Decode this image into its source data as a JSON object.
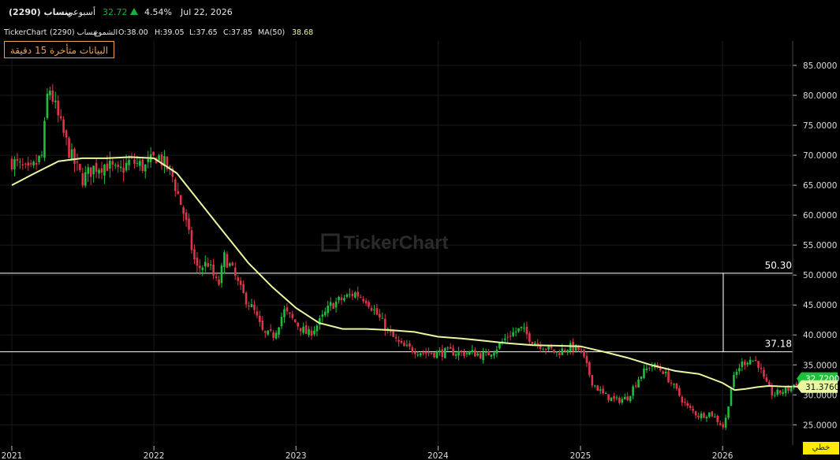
{
  "header": {
    "symbol": "ينساب (2290)",
    "timeframe": "أسبوعي",
    "last_price": "32.72",
    "change_percent": "4.54%",
    "date": "Jul 22, 2026",
    "up_color": "#18b13c",
    "arrow_icon": "triangle-up-icon"
  },
  "infobar": {
    "brand": "TickerChart",
    "symbol": "ينساب (2290)",
    "chart_kind": "الشموع",
    "open": "O:38.00",
    "high": "H:39.05",
    "low": "L:37.65",
    "close": "C:37.85",
    "ma_label": "MA(50)",
    "ma_value": "38.68"
  },
  "delay_notice": "البيانات متأخرة 15 دقيقة",
  "watermark": "TickerChart",
  "mode_badge": "خطي",
  "colors": {
    "up": "#1fbf3b",
    "down": "#e0344a",
    "ma": "#eaf7a1",
    "grid": "#1a1a1a",
    "hline": "#ffffff",
    "badge": "#f0a04b"
  },
  "chart_data": {
    "type": "candlestick",
    "title": "",
    "xlabel": "",
    "ylabel": "",
    "x_ticks": [
      "2021",
      "2022",
      "2023",
      "2024",
      "2025",
      "2026"
    ],
    "y_ticks": [
      "85.0000",
      "80.0000",
      "75.0000",
      "70.0000",
      "65.0000",
      "60.0000",
      "55.0000",
      "50.0000",
      "45.0000",
      "40.0000",
      "35.0000",
      "30.0000",
      "25.0000"
    ],
    "ylim": [
      22.5,
      88.5
    ],
    "grid": true,
    "horizontal_lines": [
      {
        "label": "50.30",
        "value": 50.3
      },
      {
        "label": "37.18",
        "value": 37.18
      }
    ],
    "price_labels": [
      {
        "label": "32.7200",
        "value": 32.72,
        "color": "#1fbf3b"
      },
      {
        "label": "31.3760",
        "value": 31.376,
        "color": "#eaf7a1"
      }
    ],
    "close_path": {
      "dates": [
        "2021-01-01",
        "2021-02-15",
        "2021-03-20",
        "2021-04-05",
        "2021-05-01",
        "2021-06-01",
        "2021-07-01",
        "2021-08-01",
        "2021-09-01",
        "2021-10-01",
        "2021-11-01",
        "2021-12-10",
        "2022-01-10",
        "2022-02-15",
        "2022-03-20",
        "2022-04-20",
        "2022-05-20",
        "2022-06-15",
        "2022-07-01",
        "2022-07-20",
        "2022-08-15",
        "2022-09-15",
        "2022-10-10",
        "2022-11-05",
        "2022-12-01",
        "2023-01-01",
        "2023-02-01",
        "2023-03-01",
        "2023-04-01",
        "2023-05-01",
        "2023-06-01",
        "2023-07-01",
        "2023-08-01",
        "2023-09-01",
        "2023-10-01",
        "2023-11-01",
        "2023-12-01",
        "2024-01-01",
        "2024-02-01",
        "2024-03-01",
        "2024-04-01",
        "2024-05-01",
        "2024-06-01",
        "2024-07-01",
        "2024-08-01",
        "2024-09-01",
        "2024-10-01",
        "2024-11-01",
        "2024-12-01",
        "2025-01-01",
        "2025-02-01",
        "2025-03-01",
        "2025-04-01",
        "2025-05-01",
        "2025-06-01",
        "2025-07-01",
        "2025-08-01",
        "2025-09-01",
        "2025-10-01",
        "2025-11-01",
        "2025-12-01",
        "2026-01-05",
        "2026-01-25",
        "2026-02-15",
        "2026-03-10",
        "2026-04-01",
        "2026-04-20",
        "2026-05-10",
        "2026-06-01",
        "2026-06-20",
        "2026-07-22"
      ],
      "values": [
        69,
        67,
        70,
        82,
        76,
        70,
        66,
        68,
        68.5,
        67,
        69,
        68,
        70,
        67,
        60,
        51,
        52,
        48,
        53,
        51,
        47,
        44,
        40,
        40,
        44,
        42,
        40,
        42,
        45,
        46,
        47,
        46,
        43,
        40,
        38,
        37.5,
        37,
        37,
        37.2,
        37,
        37,
        36.5,
        38,
        40,
        41,
        39,
        38,
        37,
        38,
        37.5,
        32,
        30,
        29,
        29.5,
        33,
        35,
        34,
        31,
        28,
        26.5,
        27,
        24.5,
        32,
        35,
        36,
        35.5,
        32,
        30,
        30.5,
        31,
        32.72
      ]
    },
    "ma50_path": {
      "dates": [
        "2021-01-01",
        "2021-03-01",
        "2021-05-01",
        "2021-07-01",
        "2021-09-01",
        "2021-11-01",
        "2022-01-01",
        "2022-03-01",
        "2022-05-01",
        "2022-07-01",
        "2022-09-01",
        "2022-11-01",
        "2023-01-01",
        "2023-03-01",
        "2023-05-01",
        "2023-07-01",
        "2023-09-01",
        "2023-11-01",
        "2024-01-01",
        "2024-03-01",
        "2024-05-01",
        "2024-07-01",
        "2024-09-01",
        "2024-11-01",
        "2025-01-01",
        "2025-03-01",
        "2025-05-01",
        "2025-07-01",
        "2025-09-01",
        "2025-11-01",
        "2026-01-01",
        "2026-02-01",
        "2026-03-01",
        "2026-04-01",
        "2026-05-01",
        "2026-06-01",
        "2026-07-22"
      ],
      "values": [
        65,
        67,
        69,
        69.5,
        69.5,
        69.7,
        69.5,
        67,
        62,
        57,
        52,
        48,
        44.5,
        42,
        41,
        41,
        40.8,
        40.5,
        39.7,
        39.4,
        39,
        38.6,
        38.3,
        38.2,
        38.1,
        37.2,
        36.2,
        35,
        34,
        33.5,
        32,
        30.8,
        31,
        31.3,
        31.5,
        31.4,
        31.376
      ]
    }
  }
}
